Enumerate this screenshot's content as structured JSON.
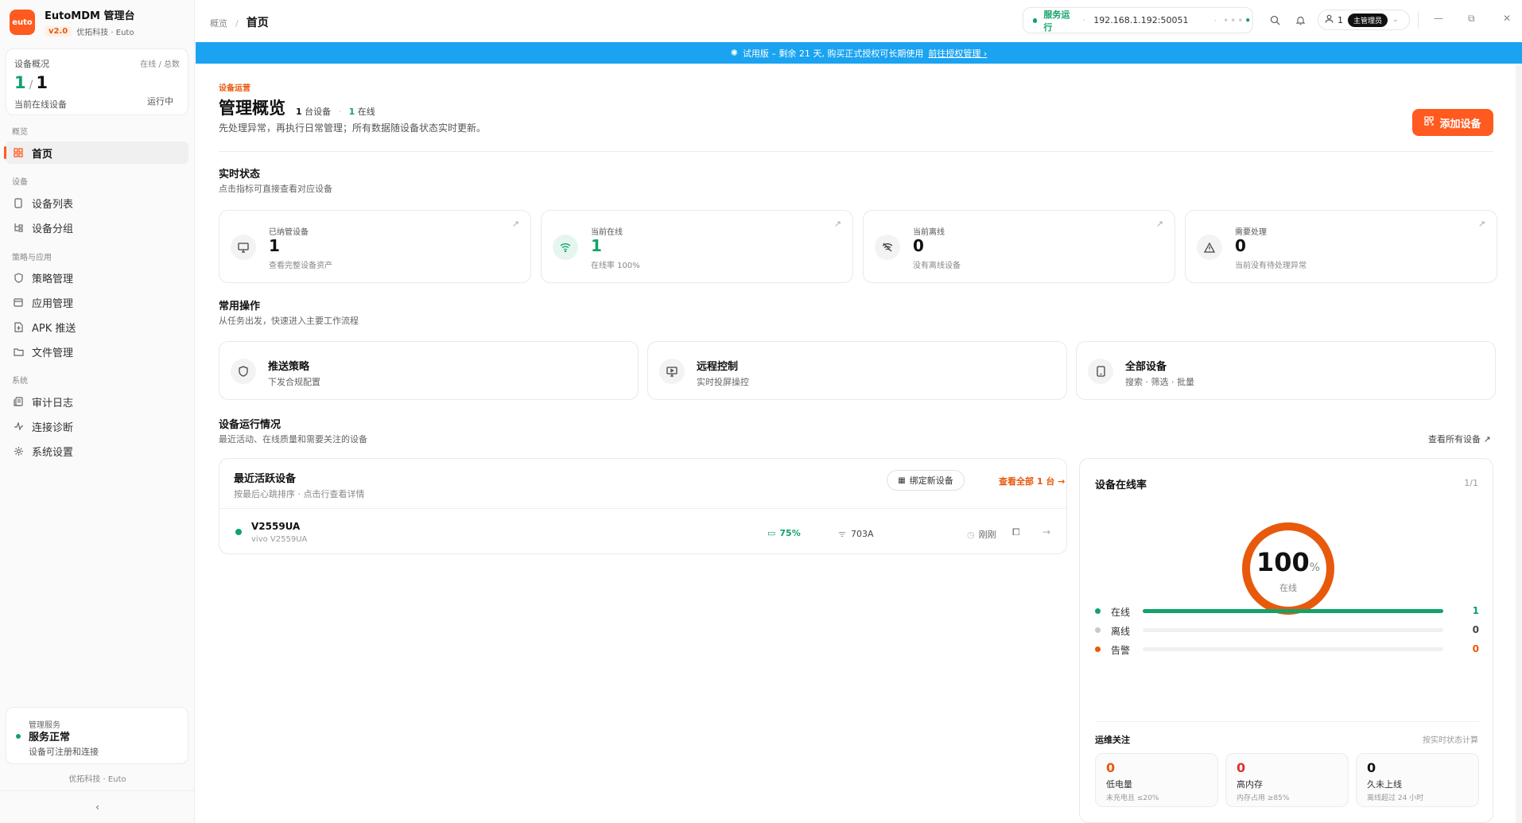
{
  "brand": {
    "logo": "euto",
    "title": "EutoMDM 管理台",
    "version": "v2.0",
    "company": "优拓科技 · Euto"
  },
  "overview": {
    "title": "设备概况",
    "right_label": "在线 / 总数",
    "online": "1",
    "total": "1",
    "caption": "当前在线设备",
    "state": "运行中"
  },
  "nav_groups": {
    "g1": "概览",
    "g2": "设备",
    "g3": "策略与应用",
    "g4": "系统"
  },
  "nav": [
    {
      "label": "首页",
      "icon": "grid-icon"
    },
    {
      "label": "设备列表",
      "icon": "phone-icon"
    },
    {
      "label": "设备分组",
      "icon": "group-icon"
    },
    {
      "label": "策略管理",
      "icon": "shield-icon"
    },
    {
      "label": "应用管理",
      "icon": "window-icon"
    },
    {
      "label": "APK 推送",
      "icon": "apk-icon"
    },
    {
      "label": "文件管理",
      "icon": "folder-icon"
    },
    {
      "label": "审计日志",
      "icon": "log-icon"
    },
    {
      "label": "连接诊断",
      "icon": "pulse-icon"
    },
    {
      "label": "系统设置",
      "icon": "gear-icon"
    }
  ],
  "service": {
    "title": "管理服务",
    "status": "服务正常",
    "note": "设备可注册和连接"
  },
  "footer": "优拓科技 · Euto",
  "collapse": "‹",
  "breadcrumb": {
    "parent": "概览",
    "sep": "/",
    "current": "首页"
  },
  "server": {
    "status": "服务运行",
    "address": "192.168.1.192:50051"
  },
  "user": {
    "count": "1",
    "role": "主管理员"
  },
  "banner": {
    "text": "试用版 – 剩余 21 天, 购买正式授权可长期使用",
    "link": "前往授权管理 ›"
  },
  "header": {
    "eyebrow": "设备运营",
    "title": "管理概览",
    "devices": "1",
    "devices_suffix": " 台设备",
    "online": "1",
    "online_suffix": " 在线",
    "description": "先处理异常，再执行日常管理；所有数据随设备状态实时更新。",
    "add_button": "添加设备"
  },
  "realtime": {
    "title": "实时状态",
    "subtitle": "点击指标可直接查看对应设备"
  },
  "stats": [
    {
      "label": "已纳管设备",
      "value": "1",
      "hint": "查看完整设备资产",
      "icon": "monitor-icon"
    },
    {
      "label": "当前在线",
      "value": "1",
      "hint": "在线率 100%",
      "icon": "wifi-icon"
    },
    {
      "label": "当前离线",
      "value": "0",
      "hint": "没有离线设备",
      "icon": "wifi-off-icon"
    },
    {
      "label": "需要处理",
      "value": "0",
      "hint": "当前没有待处理异常",
      "icon": "warning-icon"
    }
  ],
  "common": {
    "title": "常用操作",
    "subtitle": "从任务出发，快速进入主要工作流程"
  },
  "actions": [
    {
      "title": "推送策略",
      "sub": "下发合规配置",
      "icon": "shield-icon"
    },
    {
      "title": "远程控制",
      "sub": "实时投屏操控",
      "icon": "screen-icon"
    },
    {
      "title": "全部设备",
      "sub": "搜索 · 筛选 · 批量",
      "icon": "phone-icon"
    }
  ],
  "running": {
    "title": "设备运行情况",
    "subtitle": "最近活动、在线质量和需要关注的设备",
    "view_all": "查看所有设备 ↗"
  },
  "recent": {
    "title": "最近活跃设备",
    "subtitle": "按最后心跳排序 · 点击行查看详情",
    "bind_button": "绑定新设备",
    "view_all": "查看全部 1 台 →"
  },
  "devices": [
    {
      "name": "V2559UA",
      "model": "vivo V2559UA",
      "battery": "75%",
      "wifi": "703A",
      "last_seen": "刚刚"
    }
  ],
  "rate": {
    "title": "设备在线率",
    "page": "1/1",
    "percent": "100",
    "unit": "%",
    "label": "在线",
    "online_fraction": 1.0
  },
  "legend": [
    {
      "label": "在线",
      "value": "1",
      "color": "#12a26a",
      "fraction": 1.0
    },
    {
      "label": "离线",
      "value": "0",
      "color": "#c8c8c8",
      "fraction": 0
    },
    {
      "label": "告警",
      "value": "0",
      "color": "#e8590c",
      "fraction": 0
    }
  ],
  "ops": {
    "title": "运维关注",
    "hint": "按实时状态计算",
    "items": [
      {
        "value": "0",
        "label": "低电量",
        "hint": "未充电且 ≤20%",
        "color": "#e8590c"
      },
      {
        "value": "0",
        "label": "高内存",
        "hint": "内存占用 ≥85%",
        "color": "#e03131"
      },
      {
        "value": "0",
        "label": "久未上线",
        "hint": "离线超过 24 小时",
        "color": "#111111"
      }
    ]
  }
}
